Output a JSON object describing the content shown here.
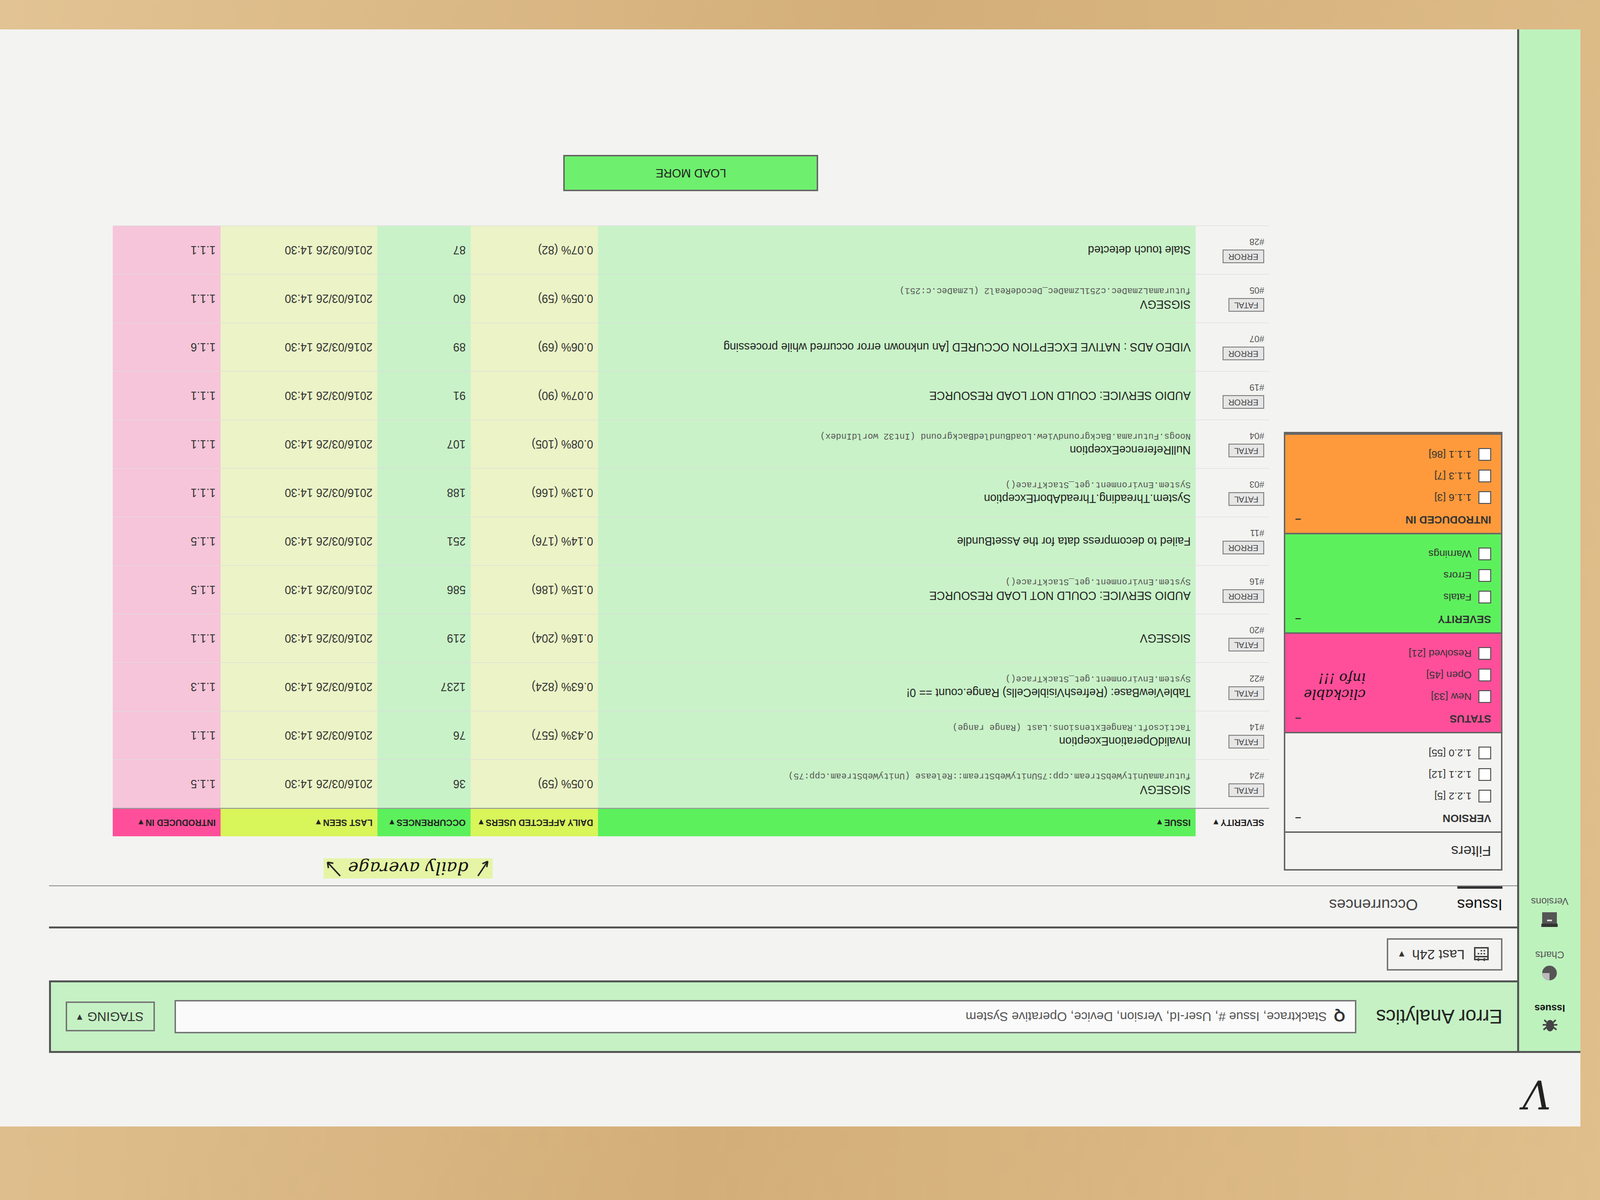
{
  "app": {
    "title": "Error Analytics",
    "environment": "STAGING",
    "environment_caret": "▾"
  },
  "search": {
    "icon": "Q",
    "placeholder": "Stacktrace, Issue #, User-Id, Version, Device, Operative System"
  },
  "nav": [
    {
      "label": "Issues",
      "selected": true
    },
    {
      "label": "Charts",
      "selected": false
    },
    {
      "label": "Versions",
      "selected": false
    }
  ],
  "period": {
    "label": "Last 24h",
    "caret": "▾"
  },
  "tabs": [
    {
      "label": "Issues",
      "selected": true
    },
    {
      "label": "Occurrences",
      "selected": false
    }
  ],
  "filters": {
    "title": "Filters",
    "sections": [
      {
        "title": "VERSION",
        "toggle": "–",
        "highlight": null,
        "items": [
          {
            "label": "1.2.2 [5]",
            "checked": false
          },
          {
            "label": "1.2.1 [12]",
            "checked": false
          },
          {
            "label": "1.2.0 [55]",
            "checked": false
          }
        ]
      },
      {
        "title": "STATUS",
        "toggle": "–",
        "highlight": "#ff4f9a",
        "items": [
          {
            "label": "New [33]",
            "checked": false
          },
          {
            "label": "Open [45]",
            "checked": false
          },
          {
            "label": "Resolved [21]",
            "checked": false
          }
        ]
      },
      {
        "title": "SEVERITY",
        "toggle": "–",
        "highlight": "#5df05d",
        "items": [
          {
            "label": "Fatals",
            "checked": false
          },
          {
            "label": "Errors",
            "checked": false
          },
          {
            "label": "Warnings",
            "checked": false
          }
        ]
      },
      {
        "title": "INTRODUCED IN",
        "toggle": "–",
        "highlight": "#ff9a3c",
        "items": [
          {
            "label": "1.1.6 [3]",
            "checked": false
          },
          {
            "label": "1.1.3 [7]",
            "checked": false
          },
          {
            "label": "1.1.1 [86]",
            "checked": false
          }
        ]
      }
    ]
  },
  "table": {
    "columns": [
      {
        "label": "SEVERITY",
        "sort": "▾",
        "highlight": null
      },
      {
        "label": "ISSUE",
        "sort": "▾",
        "highlight": "#5df05d"
      },
      {
        "label": "DAILY AFFECTED USERS",
        "sort": "▾",
        "highlight": "#d8f55a"
      },
      {
        "label": "OCCURRENCES",
        "sort": "▾",
        "highlight": "#5df05d"
      },
      {
        "label": "LAST SEEN",
        "sort": "▾",
        "highlight": "#d8f55a"
      },
      {
        "label": "INTRODUCED IN",
        "sort": "▾",
        "highlight": "#ff4f9a"
      }
    ],
    "rows": [
      {
        "severity": "FATAL",
        "id": "#24",
        "title": "SIGSEGV",
        "detail": "futuramaUnityWebStream.cpp:75UnityWebStream::Release (UnityWebStream.cpp:75)",
        "users": "0.05% (59)",
        "occurrences": "36",
        "last_seen": "2016/03/26 14:30",
        "version": "1.1.5"
      },
      {
        "severity": "FATAL",
        "id": "#14",
        "title": "InvalidOperationException",
        "detail": "Tacticsoft.RangeExtensions.Last (Range range)",
        "users": "0.43% (557)",
        "occurrences": "76",
        "last_seen": "2016/03/26 14:30",
        "version": "1.1.1"
      },
      {
        "severity": "FATAL",
        "id": "#22",
        "title": "TableViewBase: (RefreshVisibleCells) Range.count == 0!",
        "detail": "System.Environment.get_StackTrace()",
        "users": "0.63% (824)",
        "occurrences": "1237",
        "last_seen": "2016/03/26 14:30",
        "version": "1.1.3"
      },
      {
        "severity": "FATAL",
        "id": "#20",
        "title": "SIGSEGV",
        "detail": "",
        "users": "0.16% (204)",
        "occurrences": "219",
        "last_seen": "2016/03/26 14:30",
        "version": "1.1.1"
      },
      {
        "severity": "ERROR",
        "id": "#16",
        "title": "AUDIO SERVICE: COULD NOT LOAD RESOURCE",
        "detail": "System.Environment.get_StackTrace()",
        "users": "0.15% (186)",
        "occurrences": "586",
        "last_seen": "2016/03/26 14:30",
        "version": "1.1.5"
      },
      {
        "severity": "ERROR",
        "id": "#11",
        "title": "Failed to decompress data for the AssetBundle",
        "detail": "",
        "users": "0.14% (176)",
        "occurrences": "251",
        "last_seen": "2016/03/26 14:30",
        "version": "1.1.5"
      },
      {
        "severity": "FATAL",
        "id": "#03",
        "title": "System.Threading.ThreadAbortException",
        "detail": "System.Environment.get_StackTrace()",
        "users": "0.13% (166)",
        "occurrences": "188",
        "last_seen": "2016/03/26 14:30",
        "version": "1.1.1"
      },
      {
        "severity": "FATAL",
        "id": "#04",
        "title": "NullReferenceException",
        "detail": "Noogs.Futurama.BackgroundView.LoadBundledBackground (Int32 worldIndex)",
        "users": "0.08% (105)",
        "occurrences": "107",
        "last_seen": "2016/03/26 14:30",
        "version": "1.1.1"
      },
      {
        "severity": "ERROR",
        "id": "#19",
        "title": "AUDIO SERVICE: COULD NOT LOAD RESOURCE",
        "detail": "",
        "users": "0.07% (90)",
        "occurrences": "91",
        "last_seen": "2016/03/26 14:30",
        "version": "1.1.1"
      },
      {
        "severity": "ERROR",
        "id": "#07",
        "title": "VIDEO ADS : NATIVE EXCEPTION OCCURED [An unknown error occurred while processing",
        "detail": "",
        "users": "0.06% (69)",
        "occurrences": "89",
        "last_seen": "2016/03/26 14:30",
        "version": "1.1.6"
      },
      {
        "severity": "FATAL",
        "id": "#05",
        "title": "SIGSEGV",
        "detail": "futuramaLzmaDec.c251LzmaDec_DecodeReal2 (LzmaDec.c:251)",
        "users": "0.05% (59)",
        "occurrences": "60",
        "last_seen": "2016/03/26 14:30",
        "version": "1.1.1"
      },
      {
        "severity": "ERROR",
        "id": "#28",
        "title": "Stale touch detected",
        "detail": "",
        "users": "0.07% (82)",
        "occurrences": "87",
        "last_seen": "2016/03/26 14:30",
        "version": "1.1.1"
      }
    ]
  },
  "load_more": "LOAD MORE",
  "annotations": {
    "daily_note": "daily average",
    "status_note": "clickable info !!!",
    "signature": "V"
  }
}
